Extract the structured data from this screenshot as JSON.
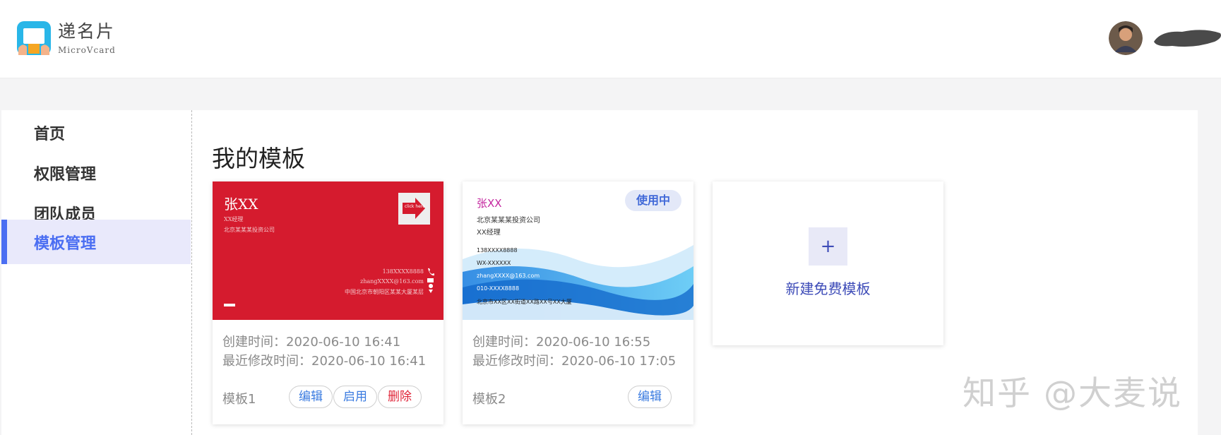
{
  "app": {
    "logo_cn": "递名片",
    "logo_en": "MicroVcard",
    "brand_color": "#29b6e8"
  },
  "user": {
    "name_visible": false
  },
  "sidebar": {
    "items": [
      {
        "label": "首页",
        "active": false
      },
      {
        "label": "权限管理",
        "active": false
      },
      {
        "label": "团队成员",
        "active": false
      },
      {
        "label": "模板管理",
        "active": true
      }
    ],
    "accent_color": "#4b6ef2"
  },
  "main": {
    "title": "我的模板",
    "templates": [
      {
        "name": "模板1",
        "created": "创建时间：2020-06-10 16:41",
        "modified": "最近修改时间：2020-06-10 16:41",
        "actions": [
          "编辑",
          "启用",
          "删除"
        ],
        "preview": {
          "name": "张XX",
          "title": "XX经理",
          "company": "北京某某某投资公司",
          "phone": "138XXXX8888",
          "email": "zhangXXXX@163.com",
          "address": "中国北京市朝阳区某某大厦某层",
          "badge": "click here",
          "bg_color": "#d51b2e"
        }
      },
      {
        "name": "模板2",
        "created": "创建时间：2020-06-10 16:55",
        "modified": "最近修改时间：2020-06-10 17:05",
        "actions": [
          "编辑"
        ],
        "status_tag": "使用中",
        "preview": {
          "name": "张XX",
          "company": "北京某某某投资公司",
          "title": "XX经理",
          "phone": "138XXXX8888",
          "wechat": "WX-XXXXXX",
          "email": "zhangXXXX@163.com",
          "tel": "010-XXXX8888",
          "address": "北京市XX区XX街道XX路XX号XX大厦"
        }
      }
    ],
    "new_template_label": "新建免费模板",
    "new_template_plus": "+"
  },
  "watermark": "知乎 @大麦说"
}
